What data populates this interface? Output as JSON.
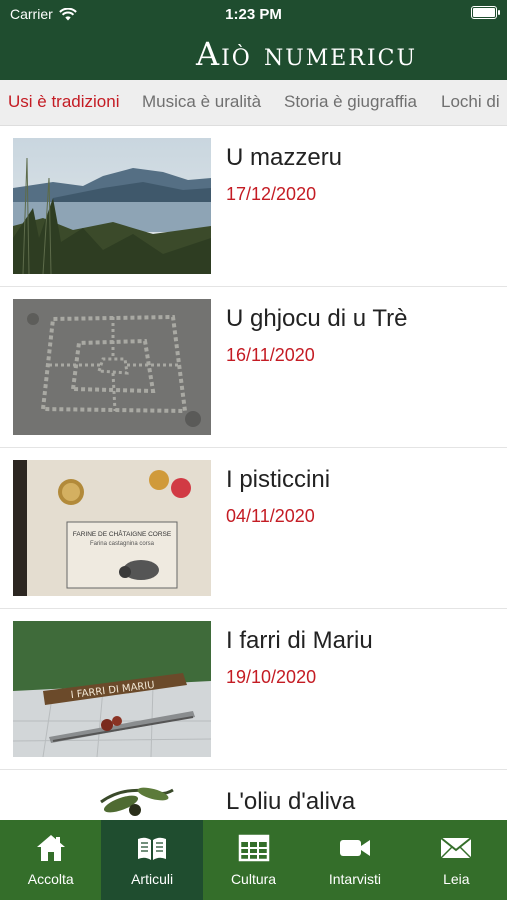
{
  "status": {
    "carrier": "Carrier",
    "time": "1:23 PM",
    "battery_level": 1.0
  },
  "app": {
    "title": "Aiò numericu"
  },
  "tabs": [
    {
      "label": "Usi è tradizioni",
      "active": true
    },
    {
      "label": "Musica è uralità",
      "active": false
    },
    {
      "label": "Storia è giugraffia",
      "active": false
    },
    {
      "label": "Lochi di",
      "active": false
    }
  ],
  "articles": [
    {
      "title": "U mazzeru",
      "date": "17/12/2020",
      "thumbnail": "lake-landscape"
    },
    {
      "title": "U ghjocu di u Trè",
      "date": "16/11/2020",
      "thumbnail": "stone-engraving"
    },
    {
      "title": "I pisticcini",
      "date": "04/11/2020",
      "thumbnail": "flour-bag",
      "thumbnail_text": [
        "FARINE DE CHÂTAIGNE CORSE",
        "Farina castagnina corsa"
      ]
    },
    {
      "title": "I farri di Mariu",
      "date": "19/10/2020",
      "thumbnail": "wooden-sign",
      "thumbnail_text": [
        "I FARRI DI MARIU"
      ]
    },
    {
      "title": "L'oliu d'aliva",
      "date": "",
      "thumbnail": "olive-branch"
    }
  ],
  "bottom_nav": [
    {
      "label": "Accolta",
      "icon": "home-icon",
      "active": false
    },
    {
      "label": "Articuli",
      "icon": "book-icon",
      "active": true
    },
    {
      "label": "Cultura",
      "icon": "table-icon",
      "active": false
    },
    {
      "label": "Intarvisti",
      "icon": "video-camera-icon",
      "active": false
    },
    {
      "label": "Leia",
      "icon": "envelope-icon",
      "active": false
    }
  ],
  "colors": {
    "header_green": "#1f4d2f",
    "nav_green": "#346e2a",
    "accent_red": "#c41c24"
  }
}
